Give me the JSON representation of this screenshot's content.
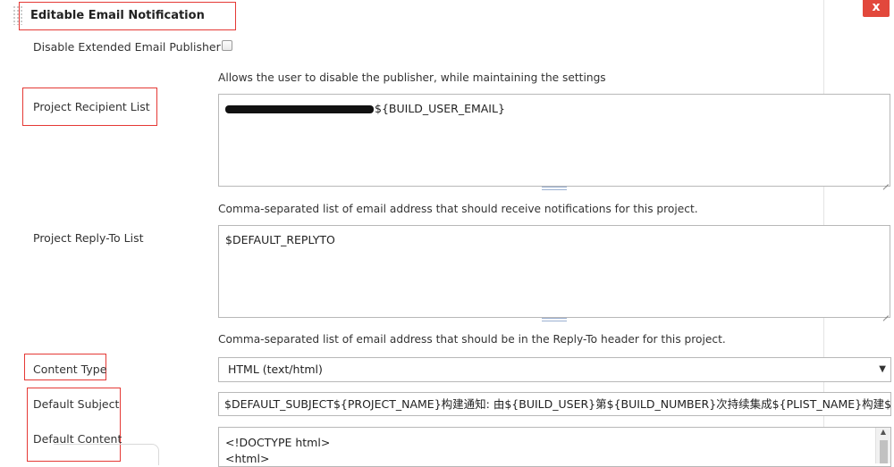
{
  "header": {
    "title": "Editable Email Notification",
    "close_label": "x"
  },
  "disable_publisher": {
    "label": "Disable Extended Email Publisher",
    "checked": false,
    "help": "Allows the user to disable the publisher, while maintaining the settings"
  },
  "recipient_list": {
    "label": "Project Recipient List",
    "value": "${BUILD_USER_EMAIL}",
    "help": "Comma-separated list of email address that should receive notifications for this project."
  },
  "reply_to": {
    "label": "Project Reply-To List",
    "value": "$DEFAULT_REPLYTO",
    "help": "Comma-separated list of email address that should be in the Reply-To header for this project."
  },
  "content_type": {
    "label": "Content Type",
    "selected": "HTML (text/html)"
  },
  "default_subject": {
    "label": "Default Subject",
    "value": "$DEFAULT_SUBJECT${PROJECT_NAME}构建通知: 由${BUILD_USER}第${BUILD_NUMBER}次持续集成${PLIST_NAME}构建${"
  },
  "default_content": {
    "label": "Default Content",
    "lines": [
      "<!DOCTYPE html>",
      "<html>"
    ]
  }
}
